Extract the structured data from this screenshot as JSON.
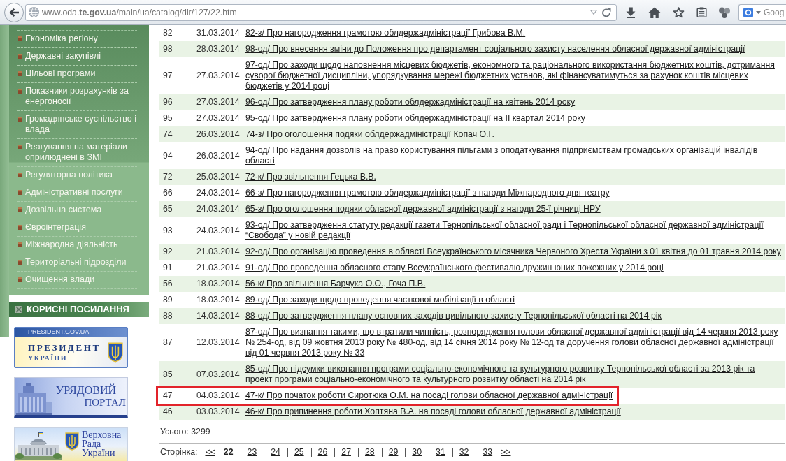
{
  "browser": {
    "url": "www.oda.**te.gov.ua**/main/ua/catalog/dir/127/22.htm",
    "search": {
      "placeholder": "Goog"
    }
  },
  "sidebar": {
    "menu": [
      "Економіка регіону",
      "Державні закупівлі",
      "Цільові програми",
      "Показники розрахунків за енергоносії",
      "Громадянське суспільство і влада",
      "Реагування на матеріали оприлюднені в ЗМІ",
      "Регуляторна політика",
      "Адміністративні послуги",
      "Дозвільна система",
      "Євроінтеграція",
      "Міжнародна діяльність",
      "Територіальні підрозділи",
      "Очищення влади"
    ],
    "useful_links": {
      "title": "КОРИСНІ ПОСИЛАННЯ",
      "banners": [
        {
          "kind": "president",
          "site": "PRESIDENT.GOV.UA",
          "title": "ПРЕЗИДЕНТ",
          "subtitle": "УКРАЇНИ"
        },
        {
          "kind": "government",
          "title": "УРЯДОВИЙ",
          "subtitle": "ПОРТАЛ"
        },
        {
          "kind": "parliament",
          "lines": [
            "Верховна",
            "Рада",
            "України"
          ]
        }
      ]
    }
  },
  "table": {
    "rows": [
      {
        "number": "82",
        "date": "31.03.2014",
        "title": "82-з/ Про нагородження грамотою облдержадміністрації Грибова В.М.",
        "highlighted": false
      },
      {
        "number": "98",
        "date": "28.03.2014",
        "title": "98-од/ Про внесення зміни до Положення про департамент соціального захисту населення обласної державної адміністрації",
        "highlighted": false
      },
      {
        "number": "97",
        "date": "27.03.2014",
        "title": "97-од/ Про заходи щодо наповнення місцевих бюджетів, економного та раціонального використання бюджетних коштів, дотримання суворої бюджетної дисципліни, упорядкування мережі бюджетних установ, які фінансуватимуться за рахунок коштів місцевих бюджетів у 2014 році",
        "highlighted": false
      },
      {
        "number": "96",
        "date": "27.03.2014",
        "title": "96-од/ Про затвердження плану роботи облдержадміністрації на квітень 2014 року",
        "highlighted": false
      },
      {
        "number": "95",
        "date": "27.03.2014",
        "title": "95-од/ Про затвердження плану роботи облдержадміністрації на II квартал 2014 року",
        "highlighted": false
      },
      {
        "number": "74",
        "date": "26.03.2014",
        "title": "74-з/ Про оголошення подяки облдержадміністрації Копач О.Г.",
        "highlighted": false
      },
      {
        "number": "94",
        "date": "26.03.2014",
        "title": "94-од/ Про надання дозволів на право користування пільгами з оподаткування підприємствам громадських організацій інвалідів області",
        "highlighted": false
      },
      {
        "number": "72",
        "date": "25.03.2014",
        "title": "72-к/ Про звільнення Гецька В.В.",
        "highlighted": false
      },
      {
        "number": "66",
        "date": "24.03.2014",
        "title": "66-з/ Про нагородження грамотою облдержадміністрації з нагоди Міжнародного дня театру",
        "highlighted": false
      },
      {
        "number": "65",
        "date": "24.03.2014",
        "title": "65-з/ Про оголошення подяки обласної державної адміністрації з нагоди 25-ї річниці НРУ",
        "highlighted": false
      },
      {
        "number": "93",
        "date": "24.03.2014",
        "title": "93-од/ Про затвердження статуту редакції газети Тернопільської обласної ради і Тернопільської обласної державної адміністрації “Свобода” у новій редакції",
        "highlighted": false
      },
      {
        "number": "92",
        "date": "21.03.2014",
        "title": "92-од/ Про організацію проведення в області Всеукраїнського місячника Червоного Хреста України з 01 квітня до 01 травня 2014 року",
        "highlighted": false
      },
      {
        "number": "91",
        "date": "21.03.2014",
        "title": "91-од/ Про проведення обласного етапу Всеукраїнського фестивалю дружин юних пожежних у 2014 році",
        "highlighted": false
      },
      {
        "number": "56",
        "date": "18.03.2014",
        "title": "56-к/ Про звільнення Барчука О.О., Гоча П.В.",
        "highlighted": false
      },
      {
        "number": "89",
        "date": "18.03.2014",
        "title": "89-од/ Про заходи щодо проведення часткової мобілізації в області",
        "highlighted": false
      },
      {
        "number": "88",
        "date": "14.03.2014",
        "title": "88-од/ Про затвердження плану основних заходів цивільного захисту Тернопільської області на 2014 рік",
        "highlighted": false
      },
      {
        "number": "87",
        "date": "12.03.2014",
        "title": "87-од/ Про визнання такими, що втратили чинність, розпорядження голови обласної державної адміністрації від 14 червня 2013 року № 254-од, від 09 жовтня 2013 року № 480-од, від 14 січня 2014 року № 12-од та доручення голови обласної державної адміністрації від 01 червня 2013 року № 33",
        "highlighted": false
      },
      {
        "number": "85",
        "date": "07.03.2014",
        "title": "85-од/ Про підсумки виконання програми соціально-економічного та культурного розвитку Тернопільської області за 2013 рік та проект програми соціально-економічного та культурного розвитку області на 2014 рік",
        "highlighted": false
      },
      {
        "number": "47",
        "date": "04.03.2014",
        "title": "47-к/ Про початок роботи Сиротюка О.М. на посаді голови обласної державної адміністрації",
        "highlighted": true
      },
      {
        "number": "46",
        "date": "03.03.2014",
        "title": "46-к/ Про припинення роботи Хоптяна В.А. на посаді голови обласної державної адміністрації",
        "highlighted": false
      }
    ]
  },
  "total": "Усього: 3299",
  "pagination": {
    "label": "Сторінка:",
    "previous": "<<",
    "pages": [
      {
        "label": "22",
        "selected": true
      },
      {
        "label": "23",
        "selected": false
      },
      {
        "label": "24",
        "selected": false
      },
      {
        "label": "25",
        "selected": false
      },
      {
        "label": "26",
        "selected": false
      },
      {
        "label": "27",
        "selected": false
      },
      {
        "label": "28",
        "selected": false
      },
      {
        "label": "29",
        "selected": false
      },
      {
        "label": "30",
        "selected": false
      },
      {
        "label": "31",
        "selected": false
      },
      {
        "label": "32",
        "selected": false
      },
      {
        "label": "33",
        "selected": false
      }
    ],
    "next": ">>"
  }
}
